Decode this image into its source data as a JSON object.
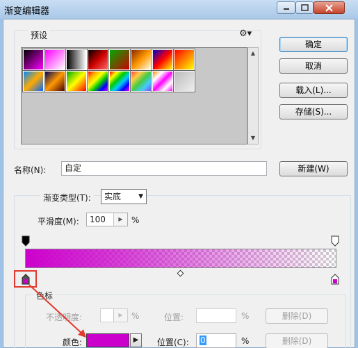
{
  "window": {
    "title": "渐变编辑器"
  },
  "presets": {
    "legend": "预设",
    "swatches": [
      "linear-gradient(135deg,#000,#f0f)",
      "linear-gradient(135deg,#f0f,#fff)",
      "linear-gradient(to right,#000,#fff)",
      "linear-gradient(135deg,#000,#c00,#f66)",
      "linear-gradient(135deg,#0a0,#c00)",
      "linear-gradient(135deg,#8b2500,#f90,#ffe)",
      "linear-gradient(135deg,#00c,#f00,#ff0)",
      "linear-gradient(135deg,#f00,#ff0)",
      "linear-gradient(135deg,#08f,#fa0,#06f)",
      "linear-gradient(135deg,#005,#f90,#400)",
      "linear-gradient(135deg,#0a0,#ff0,#f00)",
      "linear-gradient(135deg,#f00,#fa0,#ff0,#0c0,#00f,#c0f)",
      "linear-gradient(135deg,#f00,#ff0,#0c0,#0cf,#00f,#f0f)",
      "linear-gradient(135deg,#f44,#fc4,#4c4,#4cf,#84f)",
      "linear-gradient(135deg,#f80,#fff,#f0f,#fff,#f0f)",
      "linear-gradient(135deg,#bbb,#eee)"
    ]
  },
  "buttons": {
    "ok": "确定",
    "cancel": "取消",
    "load": "载入(L)...",
    "save": "存储(S)...",
    "new": "新建(W)",
    "delete_opacity": "删除(D)",
    "delete_color": "删除(D)"
  },
  "name": {
    "label": "名称(N):",
    "value": "自定"
  },
  "gradient": {
    "type_label": "渐变类型(T):",
    "type_value": "实底",
    "smoothness_label": "平滑度(M):",
    "smoothness_value": "100",
    "percent": "%"
  },
  "stops": {
    "legend": "色标",
    "opacity_label": "不透明度:",
    "location_label_disabled": "位置:",
    "percent": "%",
    "color_label": "颜色:",
    "color_value": "#cc00cc",
    "location_label": "位置(C):",
    "location_value": "0"
  },
  "colors": {
    "accent_magenta": "#cc00cc",
    "highlight_red": "#e03a2e"
  }
}
